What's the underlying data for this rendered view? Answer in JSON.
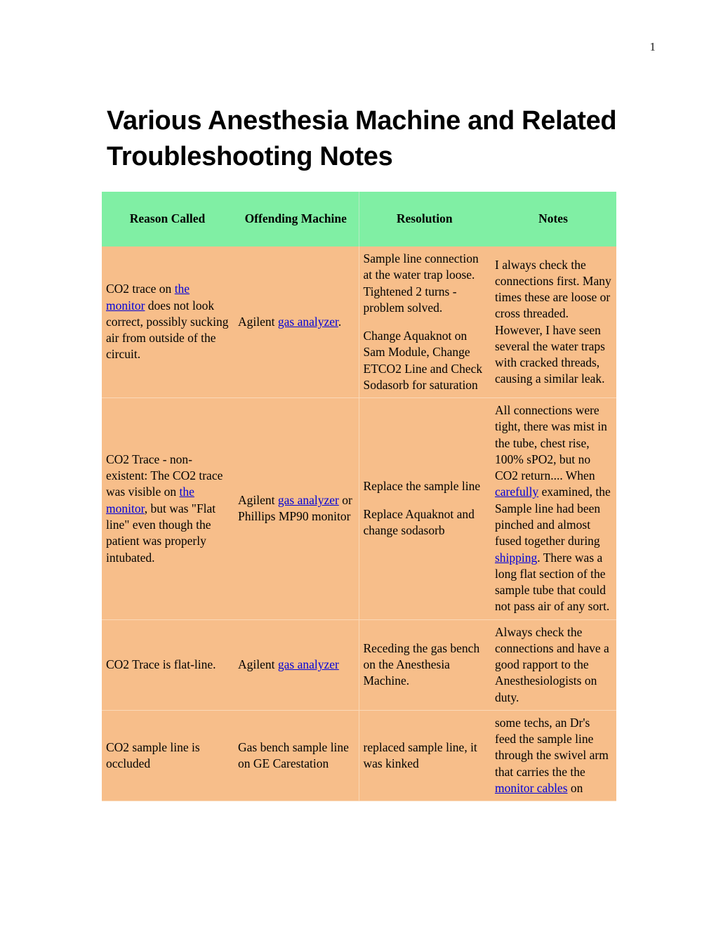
{
  "page": {
    "number": "1",
    "title": "Various Anesthesia Machine and Related Troubleshooting Notes"
  },
  "table": {
    "headers": [
      "Reason Called",
      "Offending Machine",
      "Resolution",
      "Notes"
    ],
    "rows": [
      {
        "reason": {
          "segments": [
            {
              "text": "CO2 trace on ",
              "link": false
            },
            {
              "text": "the monitor",
              "link": true
            },
            {
              "text": " does not look correct, possibly sucking air from outside of the circuit.",
              "link": false
            }
          ]
        },
        "machine": {
          "segments": [
            {
              "text": "Agilent ",
              "link": false
            },
            {
              "text": "gas analyzer",
              "link": true
            },
            {
              "text": ".",
              "link": false
            }
          ]
        },
        "resolution": {
          "paragraphs": [
            {
              "segments": [
                {
                  "text": "Sample line connection at the water trap loose. Tightened 2 turns - problem solved.",
                  "link": false
                }
              ]
            },
            {
              "segments": [
                {
                  "text": "Change Aquaknot on Sam Module, Change ETCO2 Line and Check Sodasorb for saturation",
                  "link": false
                }
              ]
            }
          ]
        },
        "notes": {
          "segments": [
            {
              "text": "I always check the connections first. Many times these are loose or cross threaded. However, I have seen several the water traps with cracked threads, causing a similar leak.",
              "link": false
            }
          ]
        }
      },
      {
        "reason": {
          "segments": [
            {
              "text": "CO2 Trace - non-existent: The CO2 trace was visible on ",
              "link": false
            },
            {
              "text": "the monitor",
              "link": true
            },
            {
              "text": ", but was \"Flat line\" even though the patient was properly intubated.",
              "link": false
            }
          ]
        },
        "machine": {
          "segments": [
            {
              "text": "Agilent ",
              "link": false
            },
            {
              "text": "gas analyzer",
              "link": true
            },
            {
              "text": " or Phillips MP90 monitor",
              "link": false
            }
          ]
        },
        "resolution": {
          "paragraphs": [
            {
              "segments": [
                {
                  "text": "Replace the sample line",
                  "link": false
                }
              ]
            },
            {
              "segments": [
                {
                  "text": "Replace Aquaknot and change sodasorb",
                  "link": false
                }
              ]
            }
          ]
        },
        "notes": {
          "segments": [
            {
              "text": "All connections were tight, there was mist in the tube, chest rise, 100% sPO2, but no CO2 return.... When ",
              "link": false
            },
            {
              "text": "carefully",
              "link": true
            },
            {
              "text": " examined, the Sample line had been pinched and almost fused together during ",
              "link": false
            },
            {
              "text": "shipping",
              "link": true
            },
            {
              "text": ". There was a long flat section of the sample tube that could not pass air of any sort.",
              "link": false
            }
          ]
        }
      },
      {
        "reason": {
          "segments": [
            {
              "text": "CO2 Trace is flat-line.",
              "link": false
            }
          ]
        },
        "machine": {
          "segments": [
            {
              "text": "Agilent ",
              "link": false
            },
            {
              "text": "gas analyzer",
              "link": true
            }
          ]
        },
        "resolution": {
          "paragraphs": [
            {
              "segments": [
                {
                  "text": "Receding the gas bench on the Anesthesia Machine.",
                  "link": false
                }
              ]
            }
          ]
        },
        "notes": {
          "segments": [
            {
              "text": "Always check the connections and have a good rapport to the Anesthesiologists on duty.",
              "link": false
            }
          ]
        }
      },
      {
        "reason": {
          "segments": [
            {
              "text": "CO2 sample line is occluded",
              "link": false
            }
          ]
        },
        "machine": {
          "segments": [
            {
              "text": "Gas bench sample line on GE Carestation",
              "link": false
            }
          ]
        },
        "resolution": {
          "paragraphs": [
            {
              "segments": [
                {
                  "text": "replaced sample line, it was kinked",
                  "link": false
                }
              ]
            }
          ]
        },
        "notes": {
          "segments": [
            {
              "text": "some techs, an Dr's feed the sample line through the swivel arm that carries the the ",
              "link": false
            },
            {
              "text": "monitor cables",
              "link": true
            },
            {
              "text": " on",
              "link": false
            }
          ]
        }
      }
    ]
  },
  "colors": {
    "header_background": "#80efa4",
    "body_background": "#f7be8a",
    "link": "#0000d8",
    "text": "#000000",
    "page_background": "#ffffff"
  }
}
